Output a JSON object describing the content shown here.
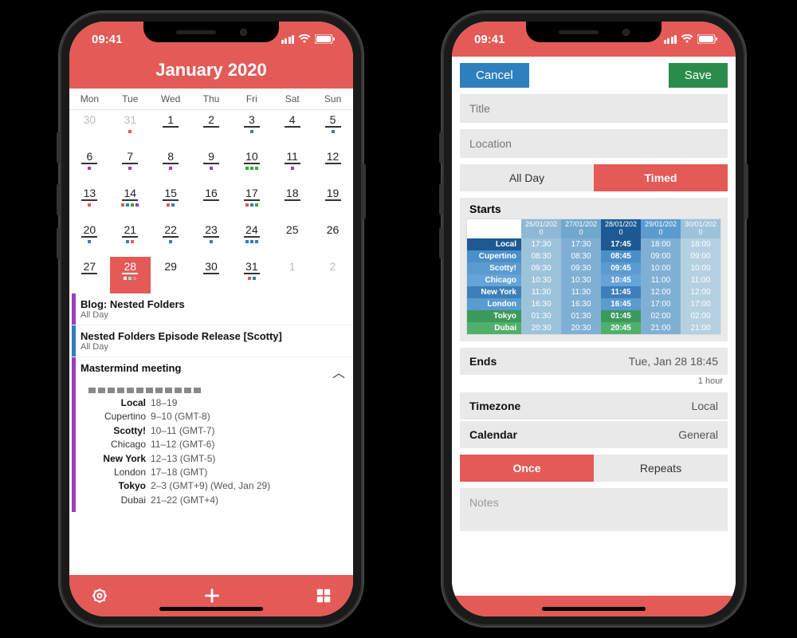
{
  "status": {
    "time": "09:41"
  },
  "left": {
    "title": "January 2020",
    "dow": [
      "Mon",
      "Tue",
      "Wed",
      "Thu",
      "Fri",
      "Sat",
      "Sun"
    ],
    "grid": [
      [
        {
          "n": "30",
          "gray": true
        },
        {
          "n": "31",
          "gray": true,
          "dots": [
            "#E35A57"
          ]
        },
        {
          "n": "1",
          "ul": true
        },
        {
          "n": "2",
          "ul": true
        },
        {
          "n": "3",
          "ul": true,
          "dots": [
            "#2E7FBE"
          ]
        },
        {
          "n": "4",
          "ul": true
        },
        {
          "n": "5",
          "ul": true,
          "dots": [
            "#2E7FBE"
          ]
        }
      ],
      [
        {
          "n": "6",
          "ul": true,
          "dots": [
            "#9b3fbf"
          ]
        },
        {
          "n": "7",
          "ul": true,
          "dots": [
            "#9b3fbf"
          ]
        },
        {
          "n": "8",
          "ul": true,
          "dots": [
            "#9b3fbf"
          ]
        },
        {
          "n": "9",
          "ul": true,
          "dots": [
            "#9b3fbf"
          ]
        },
        {
          "n": "10",
          "ul": true,
          "dots": [
            "#3a3",
            "#3a3",
            "#3a3"
          ]
        },
        {
          "n": "11",
          "ul": true,
          "dots": [
            "#9b3fbf"
          ]
        },
        {
          "n": "12",
          "ul": true
        }
      ],
      [
        {
          "n": "13",
          "ul": true,
          "dots": [
            "#E35A57"
          ]
        },
        {
          "n": "14",
          "ul": true,
          "dots": [
            "#E35A57",
            "#2E7FBE",
            "#3a3",
            "#9b3fbf"
          ]
        },
        {
          "n": "15",
          "ul": true,
          "dots": [
            "#E35A57",
            "#2E7FBE"
          ]
        },
        {
          "n": "16",
          "ul": true
        },
        {
          "n": "17",
          "ul": true,
          "dots": [
            "#E35A57",
            "#2E7FBE",
            "#3a3"
          ]
        },
        {
          "n": "18",
          "ul": true
        },
        {
          "n": "19",
          "ul": true
        }
      ],
      [
        {
          "n": "20",
          "ul": true,
          "dots": [
            "#2E7FBE"
          ]
        },
        {
          "n": "21",
          "ul": true,
          "dots": [
            "#2E7FBE",
            "#E35A57"
          ]
        },
        {
          "n": "22",
          "ul": true,
          "dots": [
            "#2E7FBE"
          ]
        },
        {
          "n": "23",
          "ul": true,
          "dots": [
            "#2E7FBE"
          ]
        },
        {
          "n": "24",
          "ul": true,
          "dots": [
            "#2E7FBE",
            "#2E7FBE",
            "#2E7FBE"
          ]
        },
        {
          "n": "25"
        },
        {
          "n": "26"
        }
      ],
      [
        {
          "n": "27",
          "ul": true
        },
        {
          "n": "28",
          "sel": true,
          "dots": [
            "#fff",
            "#7fd",
            "#f7a"
          ]
        },
        {
          "n": "29"
        },
        {
          "n": "30",
          "ul": true
        },
        {
          "n": "31",
          "ul": true,
          "dots": [
            "#E35A57",
            "#2E7FBE"
          ]
        },
        {
          "n": "1",
          "gray": true
        },
        {
          "n": "2",
          "gray": true
        }
      ]
    ],
    "events": [
      {
        "color": "#9b3fbf",
        "title": "Blog: Nested Folders",
        "sub": "All Day"
      },
      {
        "color": "#2E7FBE",
        "title": "Nested Folders Episode Release [Scotty]",
        "sub": "All Day"
      }
    ],
    "expanded": {
      "color": "#9b3fbf",
      "title": "Mastermind meeting",
      "tz": [
        {
          "lbl": "Local",
          "val": "18–19",
          "bold": true
        },
        {
          "lbl": "Cupertino",
          "val": "9–10 (GMT-8)"
        },
        {
          "lbl": "Scotty!",
          "val": "10–11 (GMT-7)",
          "bold": true
        },
        {
          "lbl": "Chicago",
          "val": "11–12 (GMT-6)"
        },
        {
          "lbl": "New York",
          "val": "12–13 (GMT-5)",
          "bold": true
        },
        {
          "lbl": "London",
          "val": "17–18 (GMT)"
        },
        {
          "lbl": "Tokyo",
          "val": "2–3 (GMT+9) (Wed, Jan 29)",
          "bold": true
        },
        {
          "lbl": "Dubai",
          "val": "21–22 (GMT+4)"
        }
      ]
    }
  },
  "right": {
    "cancel": "Cancel",
    "save": "Save",
    "title_ph": "Title",
    "location_ph": "Location",
    "seg_allday": "All Day",
    "seg_timed": "Timed",
    "starts": "Starts",
    "ends_k": "Ends",
    "ends_v": "Tue, Jan 28 18:45",
    "duration": "1 hour",
    "timezone_k": "Timezone",
    "timezone_v": "Local",
    "calendar_k": "Calendar",
    "calendar_v": "General",
    "seg_once": "Once",
    "seg_repeats": "Repeats",
    "notes_ph": "Notes",
    "picker": {
      "dates": [
        "26/01/2020",
        "27/01/2020",
        "28/01/2020",
        "29/01/2020",
        "30/01/2020"
      ],
      "rows": [
        {
          "lab": "Local",
          "bg": "#1d5a94",
          "vals": [
            "17:30",
            "17:45",
            "18:00"
          ],
          "bold": true
        },
        {
          "lab": "Cupertino",
          "bg": "#4a8fc7",
          "vals": [
            "08:30",
            "08:45",
            "09:00"
          ]
        },
        {
          "lab": "Scotty!",
          "bg": "#5a9bd0",
          "vals": [
            "09:30",
            "09:45",
            "10:00"
          ]
        },
        {
          "lab": "Chicago",
          "bg": "#66a3d6",
          "vals": [
            "10:30",
            "10:45",
            "11:00"
          ]
        },
        {
          "lab": "New York",
          "bg": "#3d7fb8",
          "vals": [
            "11:30",
            "11:45",
            "12:00"
          ]
        },
        {
          "lab": "London",
          "bg": "#5a9bd0",
          "vals": [
            "16:30",
            "16:45",
            "17:00"
          ]
        },
        {
          "lab": "Tokyo",
          "bg": "#3a9a5a",
          "vals": [
            "01:30",
            "01:45",
            "02:00"
          ]
        },
        {
          "lab": "Dubai",
          "bg": "#4fb06a",
          "vals": [
            "20:30",
            "20:45",
            "21:00"
          ]
        }
      ]
    }
  }
}
